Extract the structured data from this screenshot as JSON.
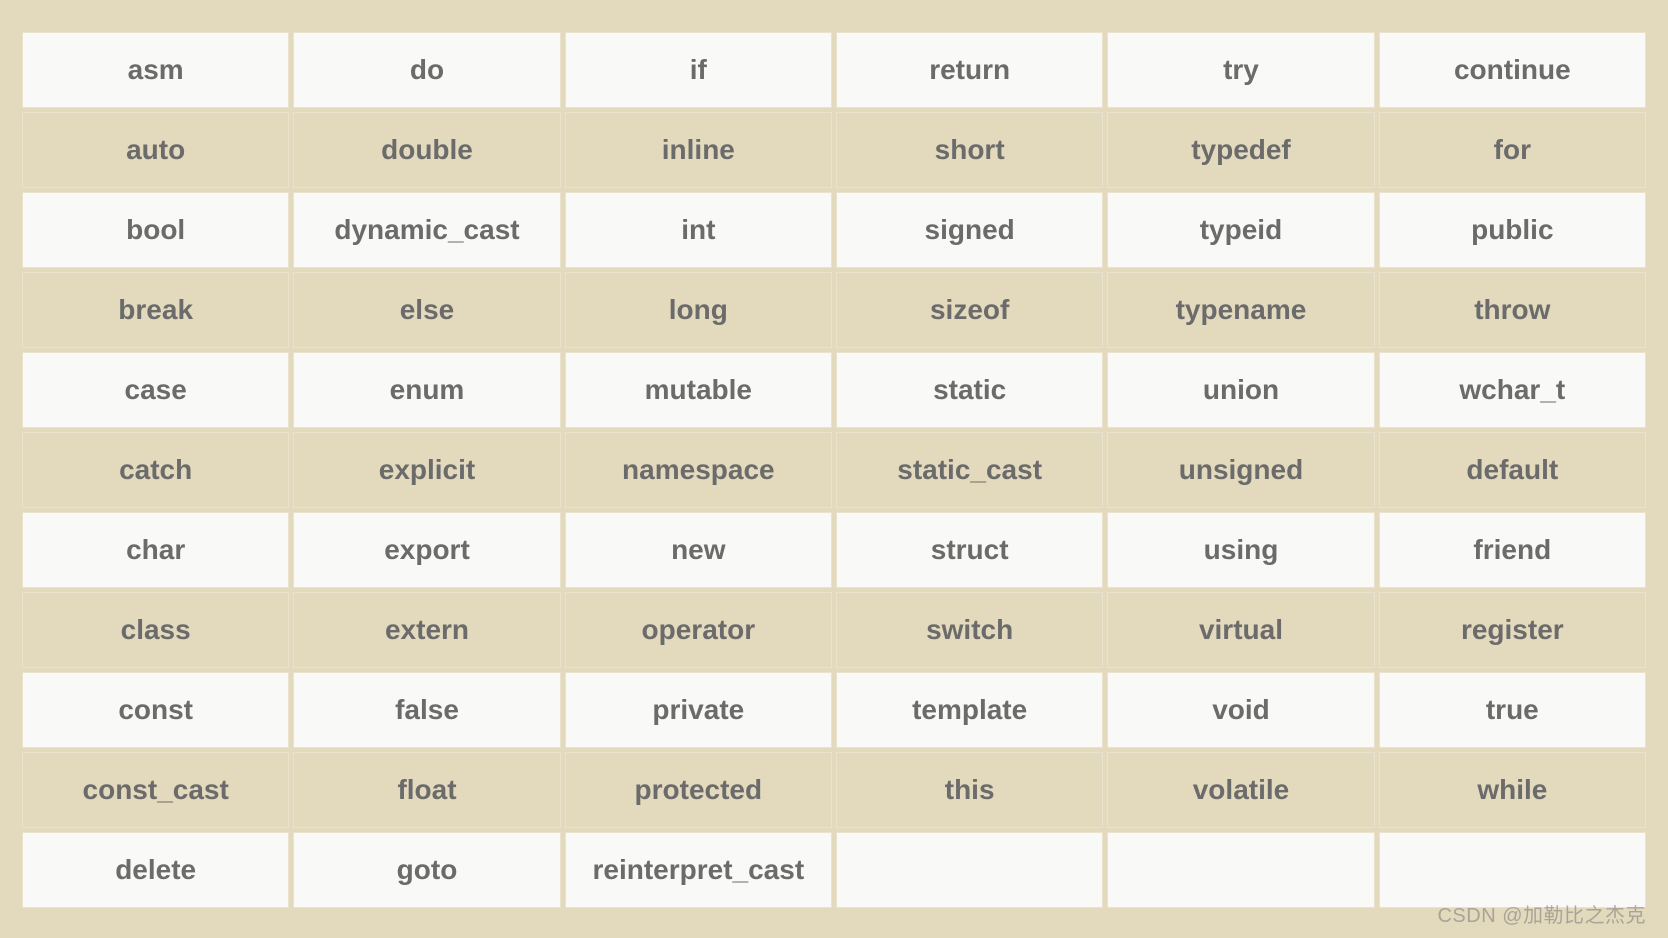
{
  "chart_data": {
    "type": "table",
    "columns": 6,
    "rows": [
      [
        "asm",
        "do",
        "if",
        "return",
        "try",
        "continue"
      ],
      [
        "auto",
        "double",
        "inline",
        "short",
        "typedef",
        "for"
      ],
      [
        "bool",
        "dynamic_cast",
        "int",
        "signed",
        "typeid",
        "public"
      ],
      [
        "break",
        "else",
        "long",
        "sizeof",
        "typename",
        "throw"
      ],
      [
        "case",
        "enum",
        "mutable",
        "static",
        "union",
        "wchar_t"
      ],
      [
        "catch",
        "explicit",
        "namespace",
        "static_cast",
        "unsigned",
        "default"
      ],
      [
        "char",
        "export",
        "new",
        "struct",
        "using",
        "friend"
      ],
      [
        "class",
        "extern",
        "operator",
        "switch",
        "virtual",
        "register"
      ],
      [
        "const",
        "false",
        "private",
        "template",
        "void",
        "true"
      ],
      [
        "const_cast",
        "float",
        "protected",
        "this",
        "volatile",
        "while"
      ],
      [
        "delete",
        "goto",
        "reinterpret_cast",
        "",
        "",
        ""
      ]
    ]
  },
  "cells": {
    "r0c0": "asm",
    "r0c1": "do",
    "r0c2": "if",
    "r0c3": "return",
    "r0c4": "try",
    "r0c5": "continue",
    "r1c0": "auto",
    "r1c1": "double",
    "r1c2": "inline",
    "r1c3": "short",
    "r1c4": "typedef",
    "r1c5": "for",
    "r2c0": "bool",
    "r2c1": "dynamic_cast",
    "r2c2": "int",
    "r2c3": "signed",
    "r2c4": "typeid",
    "r2c5": "public",
    "r3c0": "break",
    "r3c1": "else",
    "r3c2": "long",
    "r3c3": "sizeof",
    "r3c4": "typename",
    "r3c5": "throw",
    "r4c0": "case",
    "r4c1": "enum",
    "r4c2": "mutable",
    "r4c3": "static",
    "r4c4": "union",
    "r4c5": "wchar_t",
    "r5c0": "catch",
    "r5c1": "explicit",
    "r5c2": "namespace",
    "r5c3": "static_cast",
    "r5c4": "unsigned",
    "r5c5": "default",
    "r6c0": "char",
    "r6c1": "export",
    "r6c2": "new",
    "r6c3": "struct",
    "r6c4": "using",
    "r6c5": "friend",
    "r7c0": "class",
    "r7c1": "extern",
    "r7c2": "operator",
    "r7c3": "switch",
    "r7c4": "virtual",
    "r7c5": "register",
    "r8c0": "const",
    "r8c1": "false",
    "r8c2": "private",
    "r8c3": "template",
    "r8c4": "void",
    "r8c5": "true",
    "r9c0": "const_cast",
    "r9c1": "float",
    "r9c2": "protected",
    "r9c3": "this",
    "r9c4": "volatile",
    "r9c5": "while",
    "r10c0": "delete",
    "r10c1": "goto",
    "r10c2": "reinterpret_cast",
    "r10c3": "",
    "r10c4": "",
    "r10c5": ""
  },
  "watermark": "CSDN @加勒比之杰克"
}
